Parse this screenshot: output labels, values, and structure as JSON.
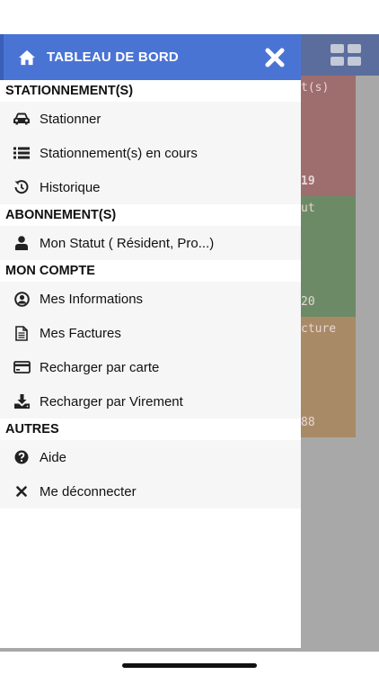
{
  "drawer": {
    "title": "TABLEAU DE BORD",
    "sections": [
      {
        "title": "STATIONNEMENT(S)",
        "items": [
          {
            "label": "Stationner",
            "icon": "car-icon"
          },
          {
            "label": "Stationnement(s) en cours",
            "icon": "list-icon"
          },
          {
            "label": "Historique",
            "icon": "history-icon"
          }
        ]
      },
      {
        "title": "ABONNEMENT(S)",
        "items": [
          {
            "label": "Mon Statut ( Résident, Pro...)",
            "icon": "user-icon"
          }
        ]
      },
      {
        "title": "MON COMPTE",
        "items": [
          {
            "label": "Mes Informations",
            "icon": "user-circle-icon"
          },
          {
            "label": "Mes Factures",
            "icon": "document-icon"
          },
          {
            "label": "Recharger par carte",
            "icon": "credit-card-icon"
          },
          {
            "label": "Recharger par Virement",
            "icon": "download-icon"
          }
        ]
      },
      {
        "title": "AUTRES",
        "items": [
          {
            "label": "Aide",
            "icon": "question-circle-icon"
          },
          {
            "label": "Me déconnecter",
            "icon": "times-icon"
          }
        ]
      }
    ]
  },
  "background": {
    "cards": [
      {
        "title": "t(s)",
        "number": "19",
        "color": "#9e6d6d"
      },
      {
        "title": "ut",
        "number": "20",
        "color": "#6d8a66"
      },
      {
        "title": "cture",
        "number": "88",
        "color": "#a88a66"
      }
    ]
  },
  "colors": {
    "header": "#4a74d4",
    "item_bg": "#f6f6f6"
  }
}
